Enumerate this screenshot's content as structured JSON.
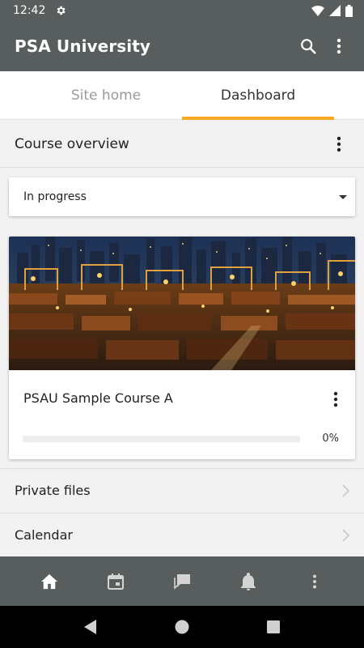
{
  "status_bar": {
    "time": "12:42"
  },
  "app_bar": {
    "title": "PSA University"
  },
  "tabs": [
    {
      "label": "Site home",
      "active": false
    },
    {
      "label": "Dashboard",
      "active": true
    }
  ],
  "course_overview": {
    "title": "Course overview",
    "filter": {
      "selected": "In progress"
    }
  },
  "courses": [
    {
      "name": "PSAU Sample Course A",
      "progress_percent": 0,
      "progress_label": "0%"
    }
  ],
  "menu_items": [
    {
      "label": "Private files"
    },
    {
      "label": "Calendar"
    }
  ],
  "bottom_nav": [
    "home-icon",
    "calendar-icon",
    "messages-icon",
    "notifications-icon",
    "more-icon"
  ],
  "colors": {
    "bar": "#585d5d",
    "accent": "#f9a825",
    "background": "#f2f2f2"
  }
}
